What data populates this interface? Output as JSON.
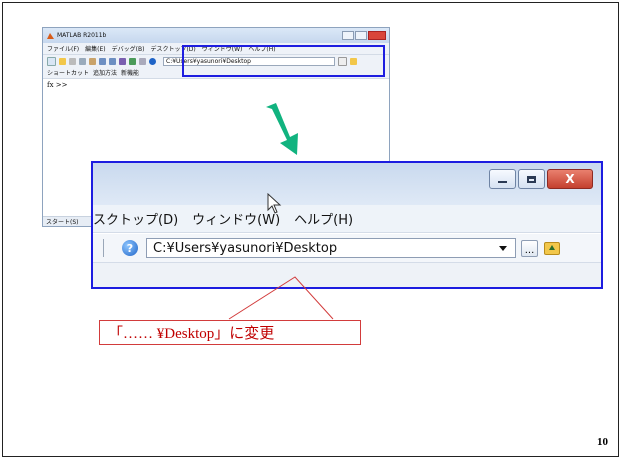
{
  "small_window": {
    "title": "MATLAB R2011b",
    "menu": [
      "ファイル(F)",
      "編集(E)",
      "デバッグ(B)",
      "デスクトップ(D)",
      "ウィンドウ(W)",
      "ヘルプ(H)"
    ],
    "path": "C:¥Users¥yasunori¥Desktop",
    "shortcuts": [
      "ショートカット",
      "追加方法",
      "新機能"
    ],
    "prompt": "fx >>",
    "status": "スタート(S)"
  },
  "zoom": {
    "menu": [
      "スクトップ(D)",
      "ウィンドウ(W)",
      "ヘルプ(H)"
    ],
    "help_symbol": "?",
    "path": "C:¥Users¥yasunori¥Desktop",
    "browse_label": "...",
    "close_symbol": "X"
  },
  "callout": {
    "text": "「…… ¥Desktop」に変更"
  },
  "slide_number": "10",
  "colors": {
    "highlight": "#1d1de0",
    "arrow": "#11b37f",
    "callout_text": "#c00000"
  }
}
